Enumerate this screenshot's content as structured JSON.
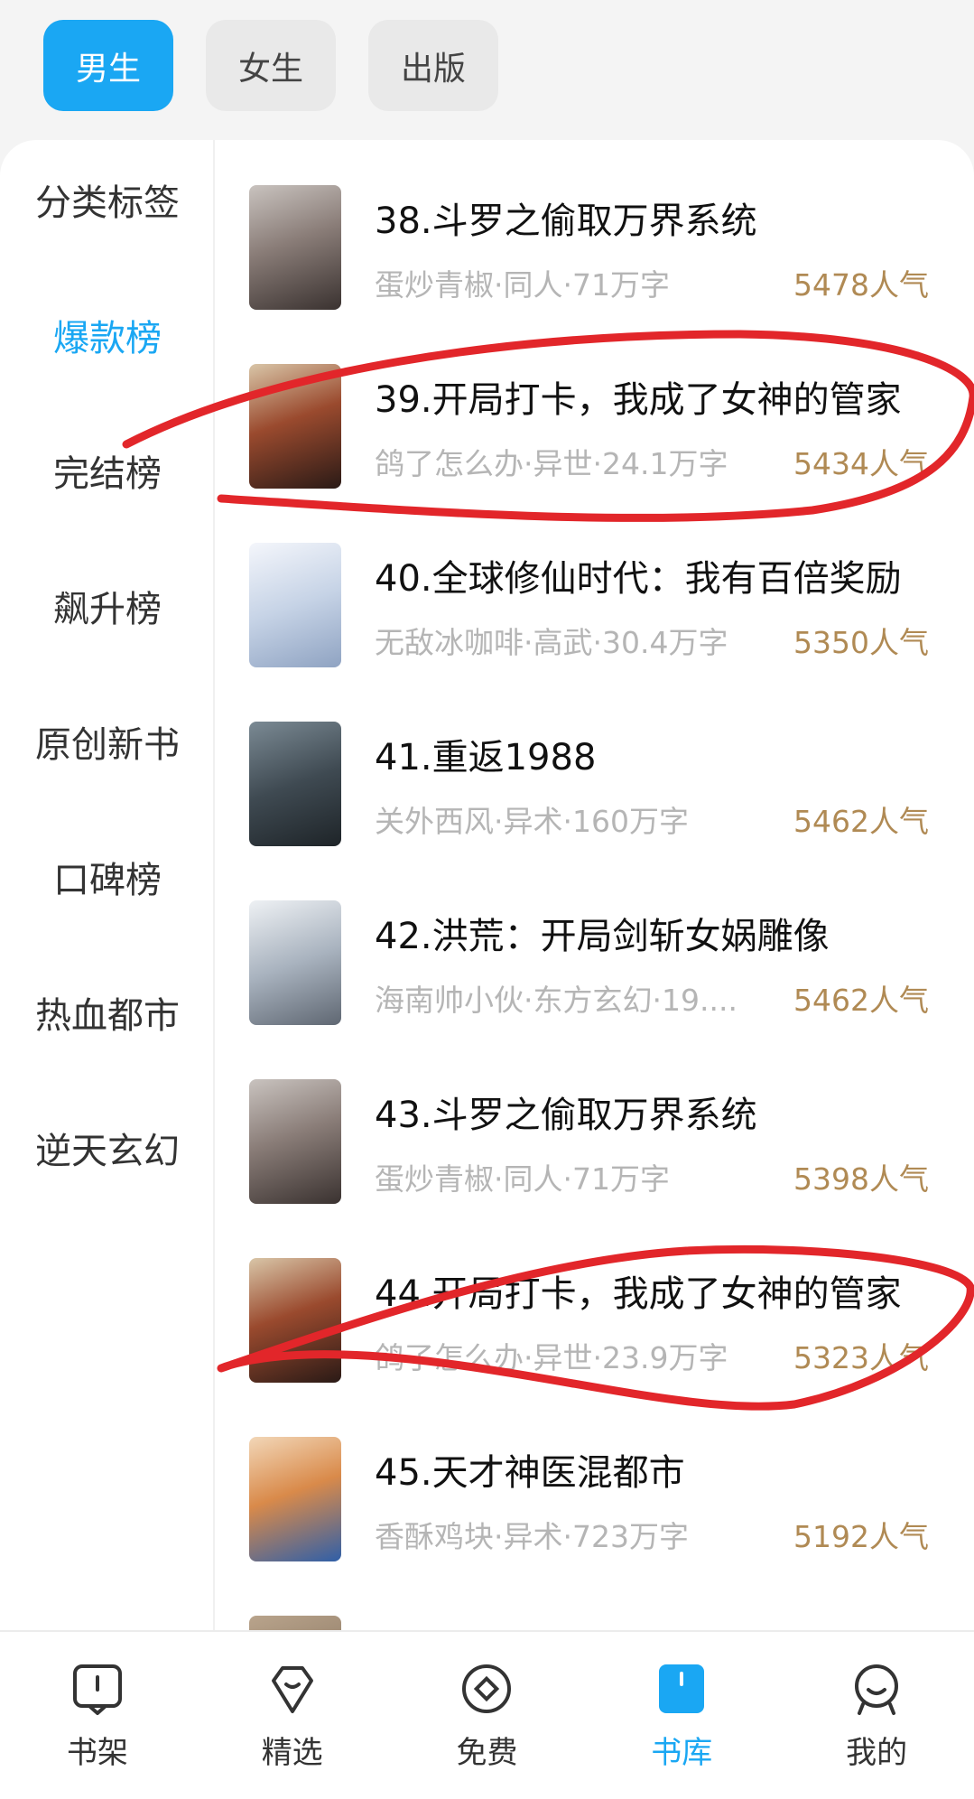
{
  "top_tabs": [
    {
      "label": "男生",
      "active": true
    },
    {
      "label": "女生",
      "active": false
    },
    {
      "label": "出版",
      "active": false
    }
  ],
  "sidebar": {
    "items": [
      {
        "label": "分类标签"
      },
      {
        "label": "爆款榜",
        "active": true
      },
      {
        "label": "完结榜"
      },
      {
        "label": "飙升榜"
      },
      {
        "label": "原创新书"
      },
      {
        "label": "口碑榜"
      },
      {
        "label": "热血都市"
      },
      {
        "label": "逆天玄幻"
      }
    ]
  },
  "books": [
    {
      "title": "38.斗罗之偷取万界系统",
      "meta": "蛋炒青椒·同人·71万字",
      "popularity": "5478人气"
    },
    {
      "title": "39.开局打卡，我成了女神的管家",
      "meta": "鸽了怎么办·异世·24.1万字",
      "popularity": "5434人气"
    },
    {
      "title": "40.全球修仙时代：我有百倍奖励",
      "meta": "无敌冰咖啡·高武·30.4万字",
      "popularity": "5350人气"
    },
    {
      "title": "41.重返1988",
      "meta": "关外西风·异术·160万字",
      "popularity": "5462人气"
    },
    {
      "title": "42.洪荒：开局剑斩女娲雕像",
      "meta": "海南帅小伙·东方玄幻·19....",
      "popularity": "5462人气"
    },
    {
      "title": "43.斗罗之偷取万界系统",
      "meta": "蛋炒青椒·同人·71万字",
      "popularity": "5398人气"
    },
    {
      "title": "44.开局打卡，我成了女神的管家",
      "meta": "鸽了怎么办·异世·23.9万字",
      "popularity": "5323人气"
    },
    {
      "title": "45.天才神医混都市",
      "meta": "香酥鸡块·异术·723万字",
      "popularity": "5192人气"
    }
  ],
  "bottom_nav": [
    {
      "label": "书架",
      "icon": "bookshelf-icon"
    },
    {
      "label": "精选",
      "icon": "featured-icon"
    },
    {
      "label": "免费",
      "icon": "free-icon"
    },
    {
      "label": "书库",
      "icon": "library-icon",
      "active": true
    },
    {
      "label": "我的",
      "icon": "profile-icon"
    }
  ],
  "colors": {
    "accent": "#1aa7f3",
    "popularity": "#b08a54",
    "annotation": "#e2262a"
  }
}
